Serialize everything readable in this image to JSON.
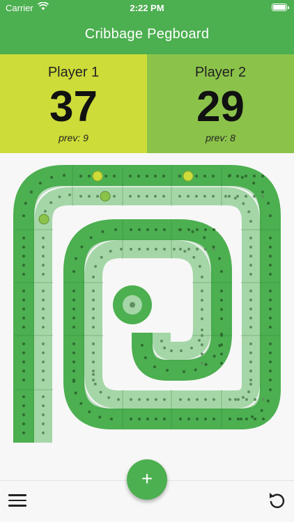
{
  "status_bar": {
    "carrier": "Carrier",
    "time": "2:22 PM"
  },
  "header": {
    "title": "Cribbage Pegboard"
  },
  "players": [
    {
      "name": "Player 1",
      "score": "37",
      "prev": "prev: 9",
      "color": "#cddc39"
    },
    {
      "name": "Player 2",
      "score": "29",
      "prev": "prev: 8",
      "color": "#8bc34a"
    }
  ],
  "board": {
    "colors": {
      "outer_track": "#4caf50",
      "inner_track": "#a5d6a7",
      "hole": "#2e6b30",
      "hole_inner": "#5f8f60",
      "peg_player1": "#cddc39",
      "peg_player2": "#8bc34a"
    }
  },
  "actions": {
    "add_label": "+"
  },
  "icons": {
    "menu": "menu-icon",
    "undo": "undo-icon",
    "add": "plus-icon",
    "wifi": "wifi-icon",
    "battery": "battery-icon"
  }
}
